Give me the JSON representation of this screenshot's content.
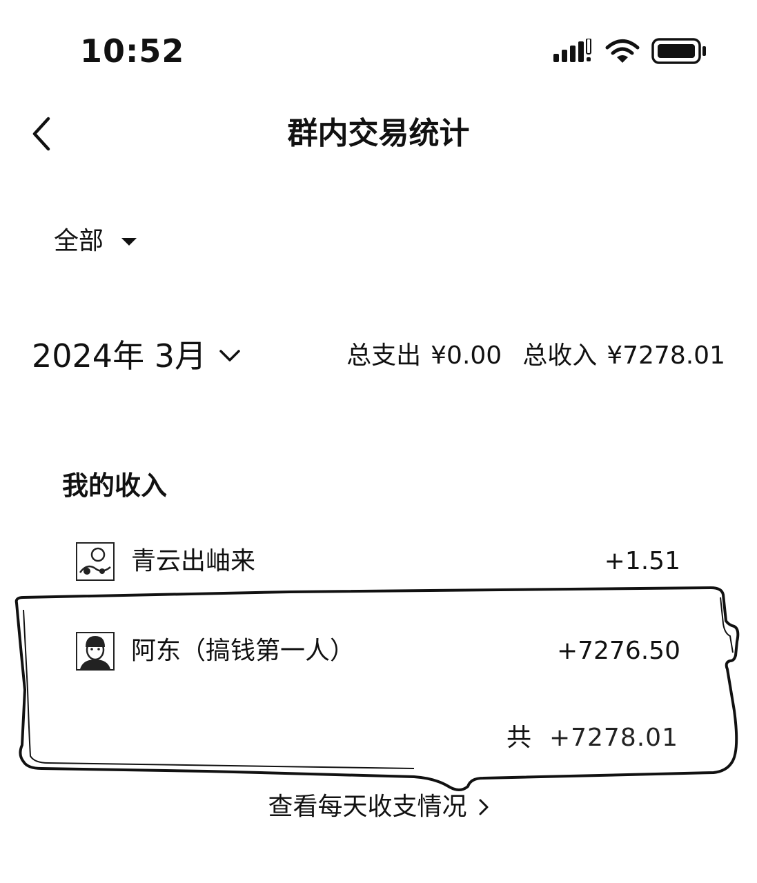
{
  "status_bar": {
    "time": "10:52",
    "icons": [
      "signal-icon",
      "wifi-icon",
      "battery-icon"
    ]
  },
  "nav": {
    "back_icon": "chevron-left-icon",
    "title": "群内交易统计"
  },
  "filter": {
    "label": "全部",
    "icon": "caret-down-icon"
  },
  "month": {
    "label": "2024年 3月",
    "icon": "chevron-down-icon"
  },
  "summary": {
    "expense_label": "总支出",
    "expense_value": "¥0.00",
    "income_label": "总收入",
    "income_value": "¥7278.01"
  },
  "income_section": {
    "title": "我的收入",
    "items": [
      {
        "name": "青云出岫来",
        "amount": "+1.51"
      },
      {
        "name": "阿东（搞钱第一人）",
        "amount": "+7276.50"
      }
    ],
    "total_label": "共",
    "total_value": "+7278.01"
  },
  "footer": {
    "daily_link": "查看每天收支情况",
    "icon": "chevron-right-icon"
  },
  "colors": {
    "text": "#111111",
    "background": "#ffffff"
  }
}
